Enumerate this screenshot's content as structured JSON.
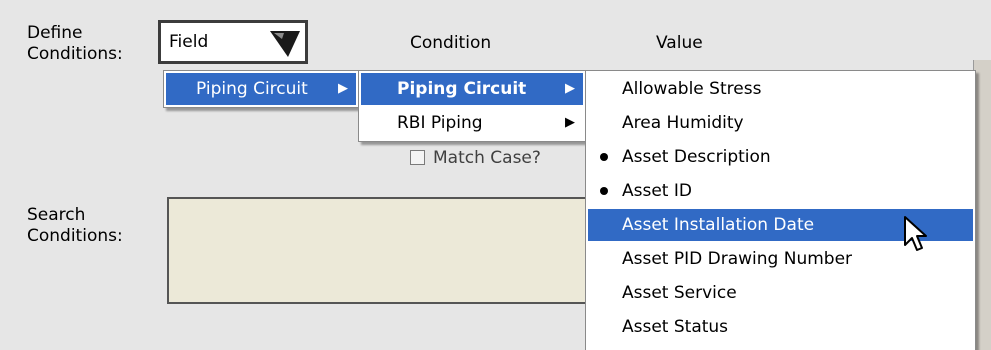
{
  "define": {
    "label_line1": "Define",
    "label_line2": "Conditions:"
  },
  "field": {
    "value": "Field"
  },
  "headers": {
    "condition": "Condition",
    "value": "Value"
  },
  "match_case": {
    "label": "Match Case?"
  },
  "search": {
    "label_line1": "Search",
    "label_line2": "Conditions:"
  },
  "menu1": {
    "items": [
      {
        "label": "Piping Circuit"
      }
    ]
  },
  "menu2": {
    "items": [
      {
        "label": "Piping Circuit"
      },
      {
        "label": "RBI Piping"
      }
    ]
  },
  "menu3": {
    "items": [
      {
        "label": "Allowable Stress"
      },
      {
        "label": "Area Humidity"
      },
      {
        "label": "Asset Description"
      },
      {
        "label": "Asset ID"
      },
      {
        "label": "Asset Installation Date"
      },
      {
        "label": "Asset PID Drawing Number"
      },
      {
        "label": "Asset Service"
      },
      {
        "label": "Asset Status"
      }
    ]
  },
  "colors": {
    "highlight": "#316ac5",
    "panel": "#e6e6e6",
    "search_box": "#ece9d8"
  },
  "icons": {
    "dropdown": "dropdown-arrow-icon",
    "submenu": "submenu-arrow-icon",
    "bullet": "bullet-icon",
    "cursor": "mouse-pointer-icon"
  }
}
